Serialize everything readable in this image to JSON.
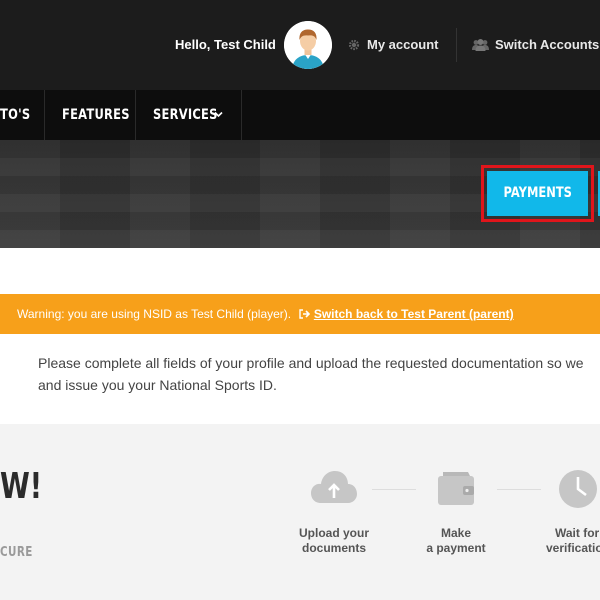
{
  "header": {
    "greeting": "Hello, Test Child",
    "my_account": "My account",
    "switch_accounts": "Switch Accounts"
  },
  "nav": {
    "items": [
      "TO'S",
      "FEATURES",
      "SERVICES"
    ]
  },
  "hero": {
    "payments_label": "PAYMENTS"
  },
  "warning": {
    "text": "Warning: you are using NSID as Test Child (player).",
    "link": "Switch back to Test Parent (parent)"
  },
  "intro": {
    "line1": "Please complete all fields of your profile and upload the requested documentation so we",
    "line2": "and issue you your National Sports ID."
  },
  "steps": {
    "heading": "W!",
    "subtext": "CURE",
    "items": [
      {
        "line1": "Upload your",
        "line2": "documents",
        "icon": "cloud-upload-icon"
      },
      {
        "line1": "Make",
        "line2": "a payment",
        "icon": "wallet-icon"
      },
      {
        "line1": "Wait for",
        "line2": "verification",
        "icon": "clock-icon"
      }
    ]
  },
  "colors": {
    "accent": "#11b8ea",
    "warning": "#f7a01a",
    "highlight": "#e0151b",
    "topbar": "#1c1c1c",
    "navbar": "#0d0d0d"
  }
}
